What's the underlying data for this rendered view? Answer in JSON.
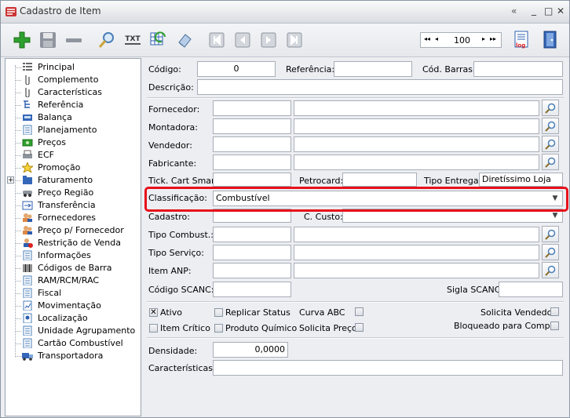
{
  "window": {
    "title": "Cadastro de Item",
    "controls": {
      "scroll": "«",
      "minimize": "_",
      "maximize": "□",
      "close": "✕"
    }
  },
  "toolbar": {
    "txt_label": "TXT",
    "page_value": "100",
    "nav_first": "◂◂",
    "nav_prev": "◂",
    "nav_next": "▸",
    "nav_last": "▸▸"
  },
  "sidebar": {
    "items": [
      {
        "label": "Principal",
        "icon": "list-icon"
      },
      {
        "label": "Complemento",
        "icon": "paperclip-icon"
      },
      {
        "label": "Características",
        "icon": "paperclip-icon"
      },
      {
        "label": "Referência",
        "icon": "tree-icon"
      },
      {
        "label": "Balança",
        "icon": "scale-icon"
      },
      {
        "label": "Planejamento",
        "icon": "document-icon"
      },
      {
        "label": "Preços",
        "icon": "money-icon"
      },
      {
        "label": "ECF",
        "icon": "printer-icon"
      },
      {
        "label": "Promoção",
        "icon": "star-icon"
      },
      {
        "label": "Faturamento",
        "icon": "folder-icon",
        "expandable": true
      },
      {
        "label": "Preço Região",
        "icon": "car-icon"
      },
      {
        "label": "Transferência",
        "icon": "transfer-icon"
      },
      {
        "label": "Fornecedores",
        "icon": "users-icon"
      },
      {
        "label": "Preço p/ Fornecedor",
        "icon": "users-icon"
      },
      {
        "label": "Restrição de Venda",
        "icon": "user-block-icon"
      },
      {
        "label": "Informações",
        "icon": "document-icon"
      },
      {
        "label": "Códigos de Barra",
        "icon": "barcode-icon"
      },
      {
        "label": "RAM/RCM/RAC",
        "icon": "document-icon"
      },
      {
        "label": "Fiscal",
        "icon": "document-icon"
      },
      {
        "label": "Movimentação",
        "icon": "chart-icon"
      },
      {
        "label": "Localização",
        "icon": "location-icon"
      },
      {
        "label": "Unidade Agrupamento",
        "icon": "document-icon"
      },
      {
        "label": "Cartão Combustível",
        "icon": "document-icon"
      },
      {
        "label": "Transportadora",
        "icon": "truck-icon"
      }
    ]
  },
  "form": {
    "codigo_label": "Código:",
    "codigo_value": "0",
    "referencia_label": "Referência:",
    "referencia_value": "",
    "cod_barras_label": "Cód. Barras:",
    "cod_barras_value": "",
    "descricao_label": "Descrição:",
    "descricao_value": "",
    "fornecedor_label": "Fornecedor:",
    "montadora_label": "Montadora:",
    "vendedor_label": "Vendedor:",
    "fabricante_label": "Fabricante:",
    "tick_cart_label": "Tick. Cart Smart:",
    "petrocard_label": "Petrocard:",
    "tipo_entrega_label": "Tipo Entrega:",
    "tipo_entrega_value": "Diretíssimo Loja",
    "classificacao_label": "Classificação:",
    "classificacao_value": "Combustível",
    "cadastro_label": "Cadastro:",
    "c_custo_label": "C. Custo:",
    "tipo_combust_label": "Tipo Combust.:",
    "tipo_servico_label": "Tipo Serviço:",
    "item_anp_label": "Item ANP:",
    "codigo_scanc_label": "Código SCANC:",
    "sigla_scanc_label": "Sigla SCANC:",
    "densidade_label": "Densidade:",
    "densidade_value": "0,0000",
    "caracteristicas_label": "Características:",
    "caracteristicas_value": ""
  },
  "checkboxes": {
    "ativo": {
      "label": "Ativo",
      "checked": true
    },
    "replicar_status": {
      "label": "Replicar Status",
      "checked": false
    },
    "curva_abc": {
      "label": "Curva ABC",
      "checked": false
    },
    "solicita_vendedor": {
      "label": "Solicita Vendedor",
      "checked": false
    },
    "item_critico": {
      "label": "Item Crítico",
      "checked": false
    },
    "produto_quimico": {
      "label": "Produto Químico",
      "checked": false
    },
    "solicita_preco": {
      "label": "Solicita Preço",
      "checked": false
    },
    "bloqueado_compra": {
      "label": "Bloqueado para Compra",
      "checked": false
    }
  },
  "colors": {
    "highlight": "#e8101a",
    "add_green": "#2ea02e",
    "accent_blue": "#2d5fb0"
  }
}
